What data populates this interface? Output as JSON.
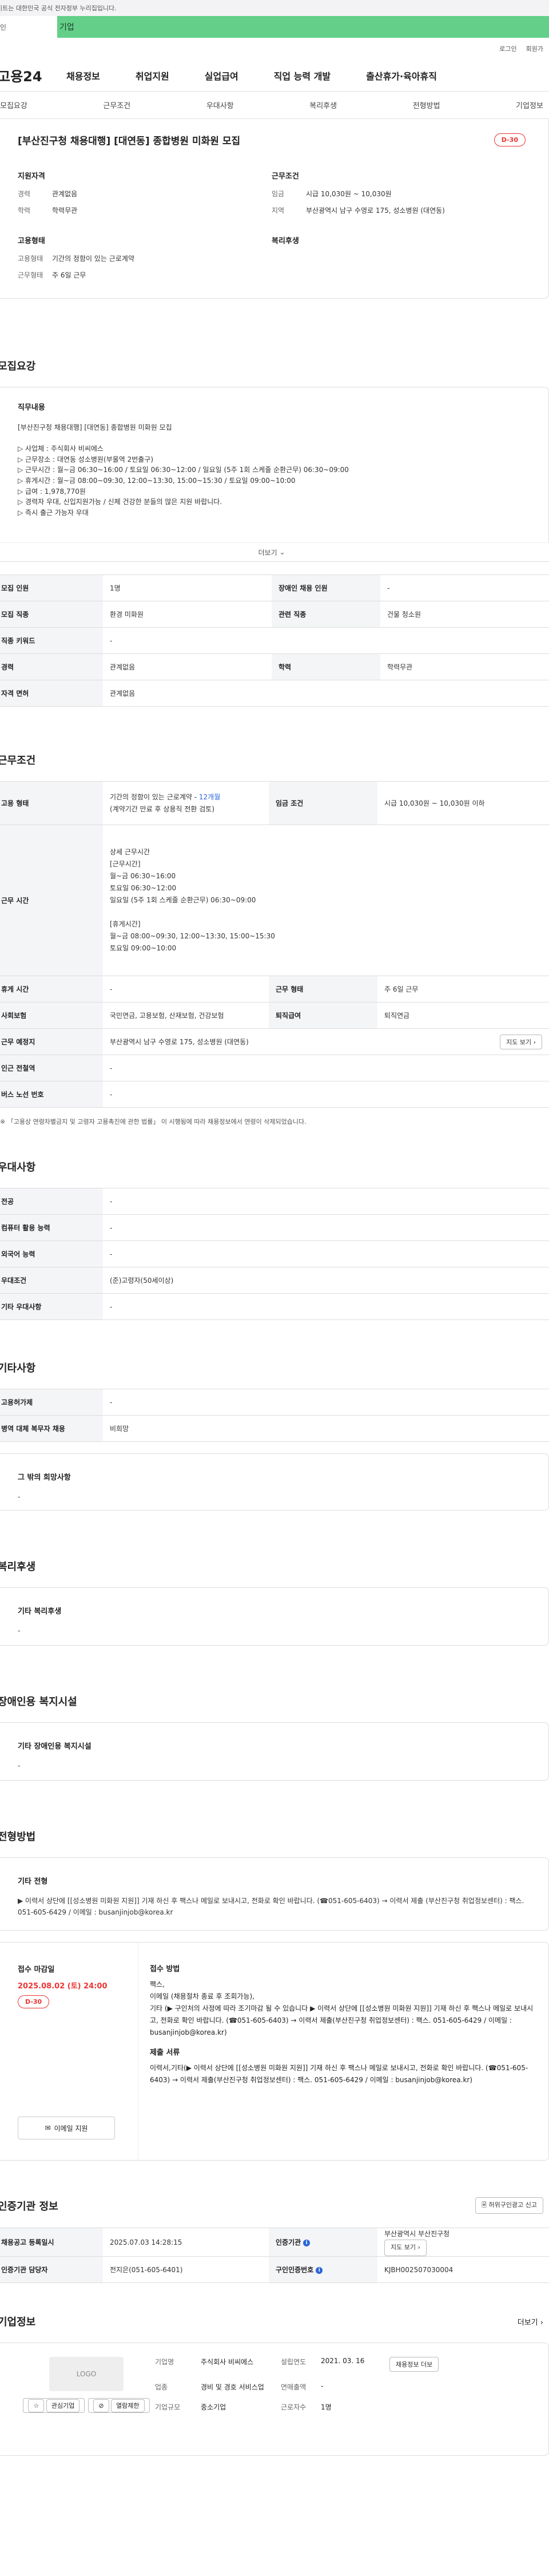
{
  "gov_banner": "이트는 대한민국 공식 전자정부 누리집입니다.",
  "strip_left": "인",
  "strip_label": "기업",
  "util": {
    "login": "로그인",
    "signup": "회원가"
  },
  "logo": "고용24",
  "gnb": [
    "채용정보",
    "취업지원",
    "실업급여",
    "직업 능력 개발",
    "출산휴가·육아휴직"
  ],
  "tabs": [
    "모집요강",
    "근무조건",
    "우대사항",
    "복리후생",
    "전형방법",
    "기업정보"
  ],
  "summary": {
    "title": "[부산진구청 채용대행] [대연동] 종합병원 미화원 모집",
    "dday": "D-30",
    "qual_title": "지원자격",
    "qual": [
      {
        "k": "경력",
        "v": "관계없음"
      },
      {
        "k": "학력",
        "v": "학력무관"
      }
    ],
    "work_title": "근무조건",
    "work": [
      {
        "k": "임금",
        "v": "시급 10,030원 ~ 10,030원"
      },
      {
        "k": "지역",
        "v": "부산광역시 남구 수영로 175, 성소병원 (대연동)"
      }
    ],
    "employ_title": "고용형태",
    "employ": [
      {
        "k": "고용형태",
        "v": "기간의 정함이 있는 근로계약"
      },
      {
        "k": "근무형태",
        "v": "주 6일 근무"
      }
    ],
    "welfare_title": "복리후생"
  },
  "recruit": {
    "section_title": "모집요강",
    "duty_title": "직무내용",
    "duty_text": "[부산진구청 채용대행] [대연동] 종합병원 미화원 모집\n\n▷ 사업체 : 주식회사 비씨에스\n▷ 근무장소 : 대연동 성소병원(부울역 2번출구)\n▷ 근무시간 : 월~금  06:30~16:00  / 토요일 06:30~12:00 / 일요일 (5주 1회 스케줄 순환근무) 06:30~09:00\n▷ 휴게시간 : 월~금  08:00~09:30, 12:00~13:30, 15:00~15:30  / 토요일 09:00~10:00\n▷ 급여 : 1,978,770원\n▷ 경력자 우대, 신입지원가능 / 신체 건강한 분들의 많은 지원 바랍니다.\n▷ 즉시 출근 가능자 우대",
    "more": "더보기",
    "rows": [
      {
        "k1": "모집 인원",
        "v1": "1명",
        "k2": "장애인 채용 인원",
        "v2": "-"
      },
      {
        "k1": "모집 직종",
        "v1": "환경 미화원",
        "k2": "관련 직종",
        "v2": "건물 청소원"
      },
      {
        "k1": "직종 키워드",
        "v1": "-"
      },
      {
        "k1": "경력",
        "v1": "관계없음",
        "k2": "학력",
        "v2": "학력무관"
      },
      {
        "k1": "자격 면허",
        "v1": "관계없음"
      }
    ]
  },
  "conditions": {
    "section_title": "근무조건",
    "employ_k": "고용 형태",
    "employ_v1": "기간의 정함이 있는 근로계약 - ",
    "employ_months": "12개월",
    "employ_v2": "(계약기간 만료 후 상용직 전환 검토)",
    "wage_k": "임금 조건",
    "wage_v": "시급 10,030원 ~ 10,030원 이하",
    "hours_k": "근무 시간",
    "hours_v": "상세 근무시간\n[근무시간]\n월~금  06:30~16:00\n토요일 06:30~12:00\n일요일 (5주 1회 스케줄 순환근무) 06:30~09:00\n\n[휴게시간]\n월~금  08:00~09:30, 12:00~13:30, 15:00~15:30\n토요일 09:00~10:00",
    "break_k": "휴게 시간",
    "break_v": "-",
    "shift_k": "근무 형태",
    "shift_v": "주 6일 근무",
    "ins_k": "사회보험",
    "ins_v": "국민연금, 고용보험, 산재보험, 건강보험",
    "retire_k": "퇴직급여",
    "retire_v": "퇴직연금",
    "place_k": "근무 예정지",
    "place_v": "부산광역시 남구 수영로 175, 성소병원 (대연동)",
    "map_btn": "지도 보기",
    "subway_k": "인근 전철역",
    "subway_v": "-",
    "bus_k": "버스 노선 번호",
    "bus_v": "-",
    "note": "※ 「고용상 연령차별금지 및 고령자 고용촉진에 관한 법률」 이 시행됨에 따라 채용정보에서 연령이 삭제되었습니다."
  },
  "prefs": {
    "section_title": "우대사항",
    "rows": [
      {
        "k": "전공",
        "v": "-"
      },
      {
        "k": "컴퓨터 활용 능력",
        "v": "-"
      },
      {
        "k": "외국어 능력",
        "v": "-"
      },
      {
        "k": "우대조건",
        "v": "(준)고령자(50세이상)"
      },
      {
        "k": "기타 우대사항",
        "v": "-"
      }
    ]
  },
  "etc": {
    "section_title": "기타사항",
    "rows": [
      {
        "k": "고용허가제",
        "v": "-"
      },
      {
        "k": "병역 대체 복무자 채용",
        "v": "비희망"
      }
    ],
    "hope_title": "그 밖의 희망사항",
    "hope_v": "-"
  },
  "welfare": {
    "section_title": "복리후생",
    "sub": "기타 복리후생",
    "v": "-"
  },
  "disabled": {
    "section_title": "장애인용 복지시설",
    "sub": "기타 장애인용 복지시설",
    "v": "-"
  },
  "selection": {
    "section_title": "전형방법",
    "sub": "기타 전형",
    "text": "▶ 이력서 상단에 [[성소병원 미화원 지원]] 기재 하신 후 팩스나 메일로 보내시고, 전화로 확인 바랍니다. (☎051-605-6403) → 이력서 제출 (부산진구청 취업정보센터) : 팩스. 051-605-6429 / 이메일 : busanjinjob@korea.kr"
  },
  "apply": {
    "deadline_title": "접수 마감일",
    "deadline": "2025.08.02 (토) 24:00",
    "dday": "D-30",
    "email_btn": "이메일 지원",
    "method_title": "접수 방법",
    "method_text": "팩스,\n이메일 (채용절차 종료 후 조회가능),\n기타 (▶ 구인처의 사정에 따라 조기마감 될 수 있습니다 ▶ 이력서 상단에 [[성소병원 미화원 지원]] 기재 하신 후 팩스나 메일로 보내시고, 전화로 확인 바랍니다. (☎051-605-6403) → 이력서 제출(부산진구청 취업정보센터) : 팩스. 051-605-6429 / 이메일 : busanjinjob@korea.kr)",
    "docs_title": "제출 서류",
    "docs_text": "이력서,기타(▶ 이력서 상단에 [[성소병원 미화원 지원]] 기재 하신 후 팩스나 메일로 보내시고, 전화로 확인 바랍니다. (☎051-605-6403) → 이력서 제출(부산진구청 취업정보센터) : 팩스. 051-605-6429 / 이메일 : busanjinjob@korea.kr)"
  },
  "cert": {
    "section_title": "인증기관 정보",
    "report_btn": "허위구인광고 신고",
    "reg_k": "채용공고 등록일시",
    "reg_v": "2025.07.03 14:28:15",
    "org_k": "인증기관",
    "org_v": "부산광역시 부산진구청",
    "map_btn": "지도 보기",
    "mgr_k": "인증기관 담당자",
    "mgr_v": "전지은(051-605-6401)",
    "no_k": "구인인증번호",
    "no_v": "KJBH002507030004"
  },
  "company": {
    "section_title": "기업정보",
    "more": "더보기",
    "logo": "LOGO",
    "btn_interest": "관심기업",
    "btn_block": "열람제한",
    "name_k": "기업명",
    "name_v": "주식회사 비씨에스",
    "est_k": "설립연도",
    "est_v": "2021. 03. 16",
    "jobs_btn": "채용정보 더보",
    "ind_k": "업종",
    "ind_v": "경비 및 경호 서비스업",
    "sales_k": "연매출액",
    "sales_v": "-",
    "emp_k": "근로자수",
    "emp_v": "1명",
    "size_k": "기업규모",
    "size_v": "중소기업"
  }
}
